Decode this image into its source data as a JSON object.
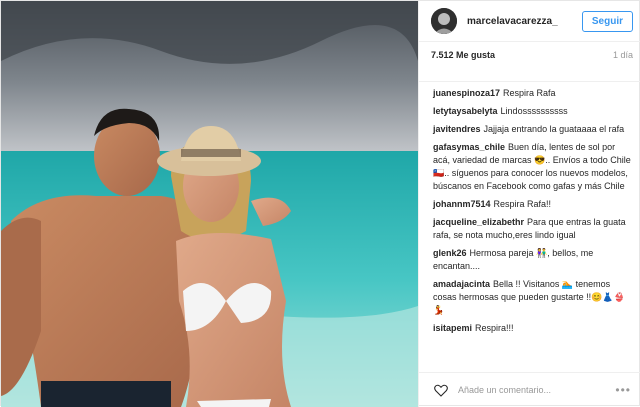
{
  "post": {
    "username": "marcelavacarezza_",
    "follow_label": "Seguir",
    "likes": "7.512 Me gusta",
    "age": "1 día"
  },
  "comments": [
    {
      "user": "juanespinoza17",
      "text": "Respira Rafa"
    },
    {
      "user": "letytaysabelyta",
      "text": "Lindossssssssss"
    },
    {
      "user": "javitendres",
      "text": "Jajjaja entrando la guataaaa el rafa"
    },
    {
      "user": "gafasymas_chile",
      "text": "Buen día, lentes de sol por acá, variedad de marcas 😎.. Envíos a todo Chile 🇨🇱.. síguenos para conocer los nuevos modelos, búscanos en Facebook como gafas y más Chile"
    },
    {
      "user": "johannm7514",
      "text": "Respira Rafa!!"
    },
    {
      "user": "jacqueline_elizabethr",
      "text": "Para que entras la guata rafa, se nota mucho,eres lindo igual"
    },
    {
      "user": "glenk26",
      "text": "Hermosa pareja 👫, bellos, me encantan...."
    },
    {
      "user": "amadajacinta",
      "text": "Bella !! Visitanos 🏊 tenemos cosas hermosas que pueden gustarte !!😊👗👙💃"
    },
    {
      "user": "isitapemi",
      "text": "Respira!!!"
    }
  ],
  "footer": {
    "placeholder": "Añade un comentario...",
    "heart_icon": "heart-outline-icon",
    "more_icon": "ellipsis-icon"
  },
  "colors": {
    "accent": "#3897f0",
    "sea": "#3fc2c0",
    "sky": "#6b7279"
  }
}
